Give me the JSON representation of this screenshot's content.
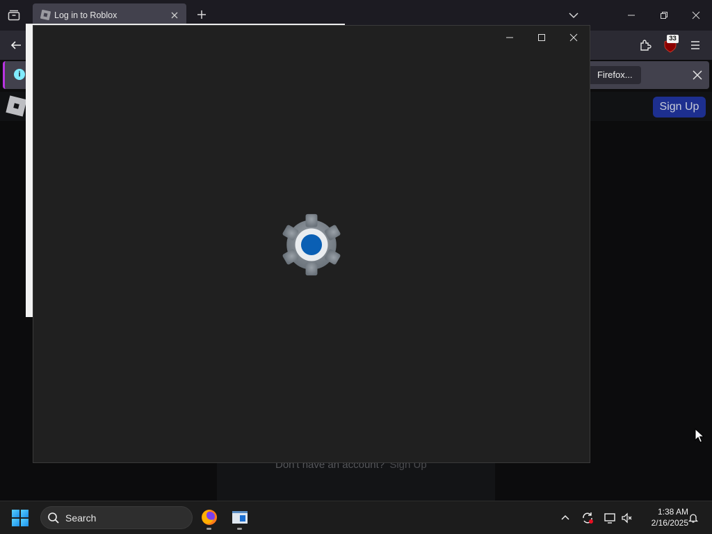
{
  "browser": {
    "tab": {
      "title": "Log in to Roblox"
    },
    "notification": {
      "button_label": "Firefox..."
    },
    "extension_badge": "33"
  },
  "page": {
    "signup_button": "Sign Up",
    "no_account_text": "Don't have an account?",
    "no_account_link": "Sign Up"
  },
  "app_window": {
    "icon": "settings-gear-icon"
  },
  "taskbar": {
    "search_label": "Search",
    "time": "1:38 AM",
    "date": "2/16/2025",
    "apps": [
      "firefox-icon",
      "app-window-icon"
    ]
  },
  "colors": {
    "accent": "#0a5fb4",
    "signup_button": "#1d2f8f",
    "notification_border": "#b833e1"
  }
}
